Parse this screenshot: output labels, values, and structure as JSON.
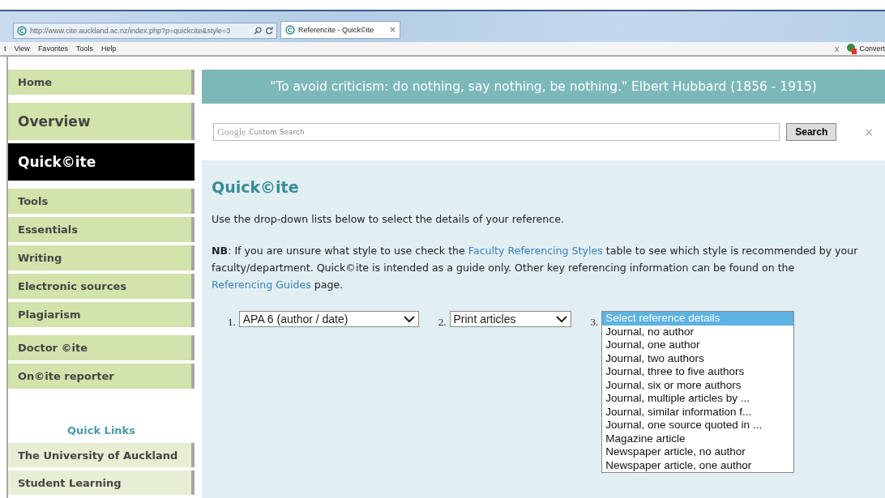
{
  "browser": {
    "address": "http://www.cite.auckland.ac.nz/index.php?p=quickcite&style=3",
    "tab_title": "Referencite - Quick©ite",
    "menu": [
      "t",
      "View",
      "Favorites",
      "Tools",
      "Help"
    ],
    "toolbar_close": "x",
    "toolbar_convert": "Convert"
  },
  "sidebar": {
    "items": [
      {
        "label": "Home",
        "kind": "normal",
        "selected": false
      },
      {
        "label": "Overview",
        "kind": "large",
        "selected": false
      },
      {
        "label": "Quick©ite",
        "kind": "large",
        "selected": true
      },
      {
        "label": "Tools",
        "kind": "normal",
        "selected": false
      },
      {
        "label": "Essentials",
        "kind": "normal",
        "selected": false
      },
      {
        "label": "Writing",
        "kind": "normal",
        "selected": false
      },
      {
        "label": "Electronic sources",
        "kind": "normal",
        "selected": false
      },
      {
        "label": "Plagiarism",
        "kind": "normal",
        "selected": false
      },
      {
        "label": "Doctor ©ite",
        "kind": "normal",
        "selected": false
      },
      {
        "label": "On©ite reporter",
        "kind": "normal",
        "selected": false
      }
    ],
    "quick_links_title": "Quick Links",
    "quick_links": [
      "The University of Auckland",
      "Student Learning"
    ]
  },
  "quote": "\"To avoid criticism: do nothing, say nothing, be nothing.\" Elbert Hubbard (1856 - 1915)",
  "search": {
    "placeholder": "Custom Search",
    "brand": "Google",
    "button": "Search",
    "close": "×"
  },
  "content": {
    "heading": "Quick©ite",
    "intro": "Use the drop-down lists below to select the details of your reference.",
    "note_parts": [
      {
        "kind": "bold",
        "text": "NB"
      },
      {
        "kind": "text",
        "text": ": If you are unsure what style to use check the "
      },
      {
        "kind": "link",
        "text": "Faculty Referencing Styles"
      },
      {
        "kind": "text",
        "text": " table to see which style is recommended by your faculty/department. Quick©ite is intended as a guide only. Other key referencing information can be found on the "
      },
      {
        "kind": "link",
        "text": "Referencing Guides"
      },
      {
        "kind": "text",
        "text": " page."
      }
    ],
    "selects": [
      {
        "number": "1.",
        "value": "APA 6 (author / date)"
      },
      {
        "number": "2.",
        "value": "Print articles"
      }
    ],
    "list": {
      "number": "3.",
      "options": [
        {
          "label": "Select reference details",
          "selected": true
        },
        {
          "label": "Journal, no author",
          "selected": false
        },
        {
          "label": "Journal, one author",
          "selected": false
        },
        {
          "label": "Journal, two authors",
          "selected": false
        },
        {
          "label": "Journal, three to five authors",
          "selected": false
        },
        {
          "label": "Journal, six or more authors",
          "selected": false
        },
        {
          "label": "Journal, multiple articles by ...",
          "selected": false
        },
        {
          "label": "Journal, similar information f...",
          "selected": false
        },
        {
          "label": "Journal, one source quoted in ...",
          "selected": false
        },
        {
          "label": "Magazine article",
          "selected": false
        },
        {
          "label": "Newspaper article, no author",
          "selected": false
        },
        {
          "label": "Newspaper article, one author",
          "selected": false
        }
      ]
    }
  }
}
